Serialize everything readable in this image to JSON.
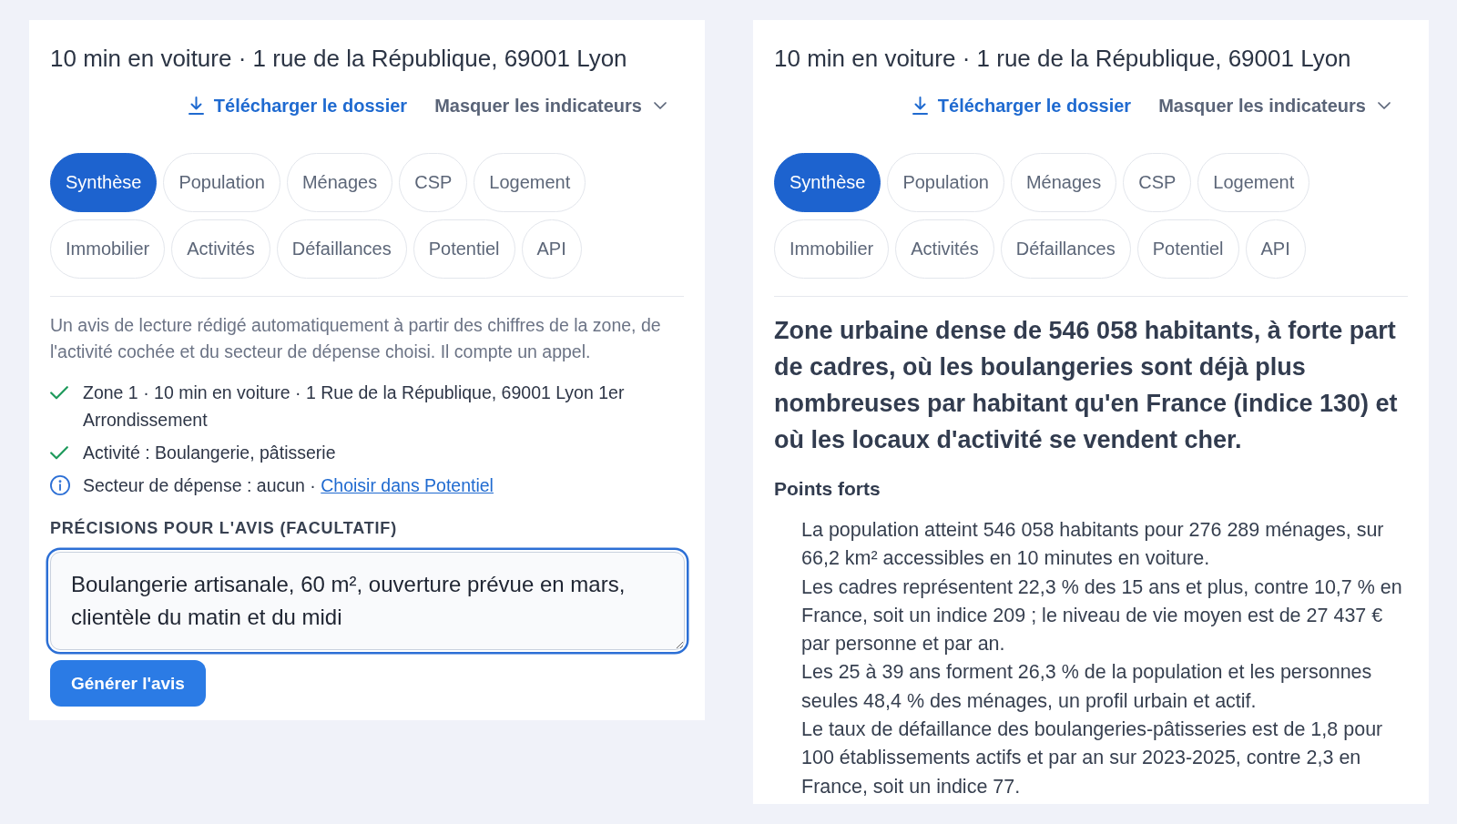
{
  "panels": [
    {
      "kind": "form",
      "title": "10 min en voiture · 1 rue de la République, 69001 Lyon",
      "download_link": "Télécharger le dossier",
      "toggle_button": "Masquer les indicateurs",
      "tabs": [
        {
          "label": "Synthèse",
          "selected": true
        },
        {
          "label": "Population",
          "selected": false
        },
        {
          "label": "Ménages",
          "selected": false
        },
        {
          "label": "CSP",
          "selected": false
        },
        {
          "label": "Logement",
          "selected": false
        },
        {
          "label": "Immobilier",
          "selected": false
        },
        {
          "label": "Activités",
          "selected": false
        },
        {
          "label": "Défaillances",
          "selected": false
        },
        {
          "label": "Potentiel",
          "selected": false
        },
        {
          "label": "API",
          "selected": false
        }
      ],
      "form": {
        "description": "Un avis de lecture rédigé automatiquement à partir des chiffres de la zone, de l'activité cochée et du secteur de dépense choisi. Il compte un appel.",
        "checklist": [
          {
            "kind": "check",
            "text": "Zone 1 · 10 min en voiture · 1 Rue de la République, 69001 Lyon 1er Arrondissement"
          },
          {
            "kind": "check",
            "text": "Activité : Boulangerie, pâtisserie"
          },
          {
            "kind": "info",
            "text": "Secteur de dépense : aucun ·",
            "link": "Choisir dans Potentiel"
          }
        ],
        "notes": {
          "label": "PRÉCISIONS POUR L'AVIS (FACULTATIF)",
          "value": "Boulangerie artisanale, 60 m², ouverture prévue en mars, clientèle du matin et du midi",
          "focused": true
        },
        "submit_button": "Générer l'avis"
      }
    },
    {
      "kind": "report",
      "title": "10 min en voiture · 1 rue de la République, 69001 Lyon",
      "download_link": "Télécharger le dossier",
      "toggle_button": "Masquer les indicateurs",
      "tabs": [
        {
          "label": "Synthèse",
          "selected": true
        },
        {
          "label": "Population",
          "selected": false
        },
        {
          "label": "Ménages",
          "selected": false
        },
        {
          "label": "CSP",
          "selected": false
        },
        {
          "label": "Logement",
          "selected": false
        },
        {
          "label": "Immobilier",
          "selected": false
        },
        {
          "label": "Activités",
          "selected": false
        },
        {
          "label": "Défaillances",
          "selected": false
        },
        {
          "label": "Potentiel",
          "selected": false
        },
        {
          "label": "API",
          "selected": false
        }
      ],
      "report": {
        "headline": "Zone urbaine dense de 546 058 habitants, à forte part de cadres, où les boulangeries sont déjà plus nombreuses par habitant qu'en France (indice 130) et où les locaux d'activité se vendent cher.",
        "section_title": "Points forts",
        "points": [
          "La population atteint 546 058 habitants pour 276 289 ménages, sur 66,2 km² accessibles en 10 minutes en voiture.",
          "Les cadres représentent 22,3 % des 15 ans et plus, contre 10,7 % en France, soit un indice 209 ; le niveau de vie moyen est de 27 437 € par personne et par an.",
          "Les 25 à 39 ans forment 26,3 % de la population et les personnes seules 48,4 % des ménages, un profil urbain et actif.",
          "Le taux de défaillance des boulangeries-pâtisseries est de 1,8 pour 100 établissements actifs et par an sur 2023-2025, contre 2,3 en France, soit un indice 77."
        ]
      }
    }
  ]
}
